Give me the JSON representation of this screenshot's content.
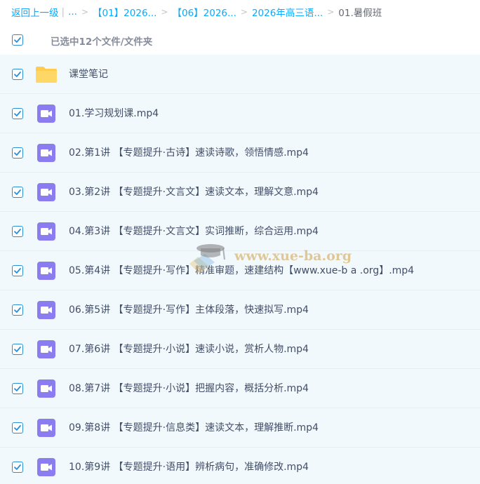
{
  "breadcrumb": {
    "back": "返回上一级",
    "ellipsis": "...",
    "items": [
      "【01】2026...",
      "【06】2026...",
      "2026年高三语..."
    ],
    "current": "01.暑假班"
  },
  "selection": {
    "label": "已选中12个文件/文件夹",
    "checked": true
  },
  "files": [
    {
      "name": "课堂笔记",
      "type": "folder",
      "icon": "folder-icon",
      "checked": true
    },
    {
      "name": "01.学习规划课.mp4",
      "type": "video",
      "icon": "video-icon",
      "checked": true
    },
    {
      "name": "02.第1讲 【专题提升·古诗】速读诗歌，领悟情感.mp4",
      "type": "video",
      "icon": "video-icon",
      "checked": true
    },
    {
      "name": "03.第2讲 【专题提升·文言文】速读文本，理解文意.mp4",
      "type": "video",
      "icon": "video-icon",
      "checked": true
    },
    {
      "name": "04.第3讲 【专题提升·文言文】实词推断，综合运用.mp4",
      "type": "video",
      "icon": "video-icon",
      "checked": true
    },
    {
      "name": "05.第4讲 【专题提升·写作】精准审题，速建结构【www.xue-b a .org】.mp4",
      "type": "video",
      "icon": "video-icon",
      "checked": true
    },
    {
      "name": "06.第5讲 【专题提升·写作】主体段落，快速拟写.mp4",
      "type": "video",
      "icon": "video-icon",
      "checked": true
    },
    {
      "name": "07.第6讲 【专题提升·小说】速读小说，赏析人物.mp4",
      "type": "video",
      "icon": "video-icon",
      "checked": true
    },
    {
      "name": "08.第7讲 【专题提升·小说】把握内容，概括分析.mp4",
      "type": "video",
      "icon": "video-icon",
      "checked": true
    },
    {
      "name": "09.第8讲 【专题提升·信息类】速读文本，理解推断.mp4",
      "type": "video",
      "icon": "video-icon",
      "checked": true
    },
    {
      "name": "10.第9讲 【专题提升·语用】辨析病句，准确修改.mp4",
      "type": "video",
      "icon": "video-icon",
      "checked": true
    }
  ],
  "watermark": {
    "text": "www.xue-ba.org",
    "icon": "graduation-cap-icon"
  },
  "colors": {
    "link": "#09aaff",
    "checkbox": "#2c8fd6",
    "video_icon": "#8b7cf0",
    "folder_icon": "#ffcc4d",
    "row_bg": "#f2f9fd"
  }
}
